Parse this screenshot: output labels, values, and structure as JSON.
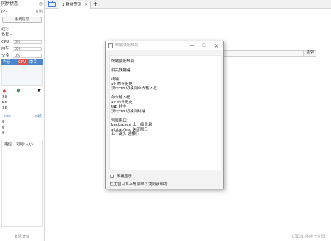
{
  "sidebar": {
    "title": "同步状态",
    "close": "◎",
    "ip_label": "IP -",
    "copy_label": "复制",
    "info_button": "系统信息",
    "run_label": "运行 -",
    "load_label": "负载 -",
    "meters": [
      {
        "label": "CPU",
        "value": "0%"
      },
      {
        "label": "内存",
        "value": "0%"
      },
      {
        "label": "交换",
        "value": "0%"
      }
    ],
    "proc_headers": {
      "mem": "内存",
      "cpu": "CPU",
      "cmd": "命令"
    },
    "net": {
      "up": "◆",
      "down": "▼",
      "tri": "▼",
      "values": [
        "98",
        "68",
        "38"
      ]
    },
    "disk": {
      "label": "0ms",
      "local": "本机",
      "values": [
        "0",
        "0",
        "0"
      ]
    },
    "path_headers": {
      "path": "路径",
      "size": "可用/大小"
    },
    "upgrade": "激活/升级"
  },
  "tabs": {
    "active_label": "1 新标签页",
    "close": "×",
    "add": "+"
  },
  "terminal": {
    "input_value": "f",
    "clear_button": "清空"
  },
  "dialog": {
    "title": "终端使用帮助",
    "controls": {
      "min": "—",
      "max": "☐",
      "close": "×"
    },
    "lines": [
      "终端使用帮助",
      "",
      "相关快捷键",
      "",
      "终端:",
      "alt 命令历史",
      "双击ctrl 切换到命令输入框",
      "",
      "命令输入框:",
      "alt 命令历史",
      "tab 补全",
      "双击ctrl 切换到终端",
      "",
      "列表窗口:",
      "backspace 上一级目录",
      "alt/tab/esc 关闭窗口",
      "上下键头 选择行"
    ],
    "dont_show": "不再显示",
    "reopen_hint": "在主窗口右上角菜单可找到该帮助"
  },
  "watermark": "CSDN @@一435",
  "colors": {
    "accent": "#4a86c8",
    "cpu_badge": "#d9534f",
    "folder": "#3a7bd5"
  }
}
